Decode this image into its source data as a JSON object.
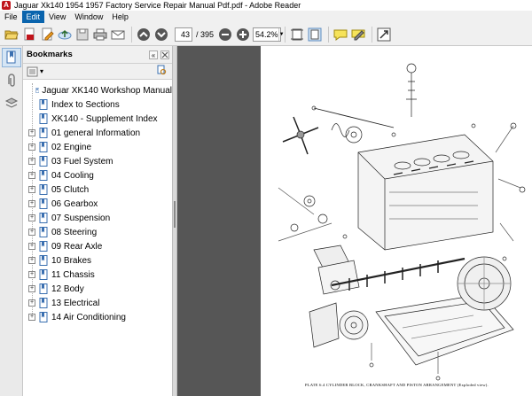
{
  "window": {
    "app_icon_label": "A",
    "title": "Jaguar Xk140 1954 1957 Factory Service Repair Manual Pdf.pdf - Adobe Reader"
  },
  "menu": {
    "items": [
      "File",
      "Edit",
      "View",
      "Window",
      "Help"
    ],
    "active": "Edit"
  },
  "toolbar": {
    "page_current": "43",
    "page_total": "/ 395",
    "zoom_value": "54.2%",
    "zoom_arrow": "▼",
    "icons": [
      "open-icon",
      "create-pdf-icon",
      "edit-icon",
      "upload-icon",
      "save-icon",
      "print-icon",
      "email-icon",
      "previous-page-icon",
      "next-page-icon",
      "zoom-out-icon",
      "zoom-in-icon",
      "fit-width-icon",
      "fit-page-icon",
      "comment-icon",
      "sign-icon",
      "fullscreen-icon"
    ]
  },
  "navigation_panel": {
    "icons": [
      "bookmarks-panel-icon",
      "attachments-icon",
      "layers-icon"
    ],
    "active": "bookmarks-panel-icon"
  },
  "bookmarks": {
    "header": "Bookmarks",
    "collapse_label": "«",
    "menu_arrow": "▾",
    "collapsed_symbol": "+",
    "items": [
      {
        "label": "Jaguar XK140 Workshop Manual",
        "expandable": false
      },
      {
        "label": "Index to Sections",
        "expandable": false
      },
      {
        "label": "XK140 - Supplement Index",
        "expandable": false
      },
      {
        "label": "01 general Information",
        "expandable": true
      },
      {
        "label": "02 Engine",
        "expandable": true
      },
      {
        "label": "03 Fuel System",
        "expandable": true
      },
      {
        "label": "04 Cooling",
        "expandable": true
      },
      {
        "label": "05 Clutch",
        "expandable": true
      },
      {
        "label": "06 Gearbox",
        "expandable": true
      },
      {
        "label": "07 Suspension",
        "expandable": true
      },
      {
        "label": "08 Steering",
        "expandable": true
      },
      {
        "label": "09 Rear Axle",
        "expandable": true
      },
      {
        "label": "10 Brakes",
        "expandable": true
      },
      {
        "label": "11 Chassis",
        "expandable": true
      },
      {
        "label": "12 Body",
        "expandable": true
      },
      {
        "label": "13 Electrical",
        "expandable": true
      },
      {
        "label": "14 Air Conditioning",
        "expandable": true
      }
    ]
  },
  "document": {
    "caption": "PLATE 6.4   CYLINDER BLOCK, CRANKSHAFT AND PISTON ARRANGEMENT (Exploded view)."
  },
  "colors": {
    "menu_active": "#0a64ad",
    "app_icon": "#c0141b",
    "doc_background": "#565656",
    "bookmark_icon": "#3a6fb0"
  }
}
